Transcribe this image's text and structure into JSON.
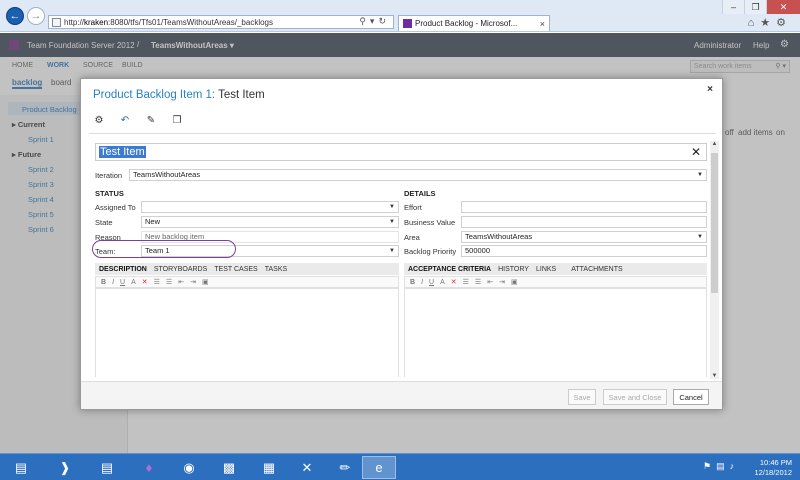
{
  "browser": {
    "address": {
      "prefix": "http://",
      "host": "kraken",
      "rest": ":8080/tfs/Tfs01/TeamsWithoutAreas/_backlogs"
    },
    "tab_title": "Product Backlog - Microsof...",
    "tab_close": "×",
    "window_controls": [
      "–",
      "❐",
      "✕"
    ],
    "icons": [
      "home-icon",
      "star-icon",
      "gear-icon"
    ]
  },
  "tfs": {
    "product_name": "Team Foundation Server 2012",
    "separator": "/",
    "team_name": "TeamsWithoutAreas ▾",
    "user": "Administrator",
    "help": "Help",
    "nav": [
      "HOME",
      "WORK",
      "SOURCE",
      "BUILD"
    ],
    "active_nav": "WORK",
    "search_placeholder": "Search work items",
    "subnav": {
      "backlog": "backlog",
      "board": "board"
    },
    "sidebar": {
      "product_backlog": "Product Backlog",
      "current": "Current",
      "future": "Future",
      "sprints_current": [
        "Sprint 1"
      ],
      "sprints_future": [
        "Sprint 2",
        "Sprint 3",
        "Sprint 4",
        "Sprint 5",
        "Sprint 6"
      ]
    },
    "bg_right": {
      "off": "off",
      "add_items": "add items",
      "on": "on"
    }
  },
  "dialog": {
    "title_prefix": "Product Backlog Item 1:",
    "title_rest": " Test Item",
    "close": "×",
    "title_value": "Test Item",
    "iteration_label": "Iteration",
    "iteration_value": "TeamsWithoutAreas",
    "status_header": "STATUS",
    "details_header": "DETAILS",
    "assigned_to_label": "Assigned To",
    "assigned_to_value": "",
    "state_label": "State",
    "state_value": "New",
    "reason_label": "Reason",
    "reason_value": "New backlog item",
    "team_label": "Team:",
    "team_value": "Team 1",
    "effort_label": "Effort",
    "business_value_label": "Business Value",
    "area_label": "Area",
    "area_value": "TeamsWithoutAreas",
    "backlog_priority_label": "Backlog Priority",
    "backlog_priority_value": "500000",
    "left_tabs": [
      "DESCRIPTION",
      "STORYBOARDS",
      "TEST CASES",
      "TASKS"
    ],
    "right_tabs": [
      "ACCEPTANCE CRITERIA",
      "HISTORY",
      "LINKS",
      "ATTACHMENTS"
    ],
    "rte_tools": [
      "B",
      "I",
      "U",
      "A",
      "✕",
      "☰",
      "☰",
      "⇤",
      "⇥",
      "▣"
    ],
    "buttons": {
      "save": "Save",
      "save_close": "Save and Close",
      "cancel": "Cancel"
    }
  },
  "taskbar": {
    "clock_time": "10:46 PM",
    "clock_date": "12/18/2012"
  }
}
